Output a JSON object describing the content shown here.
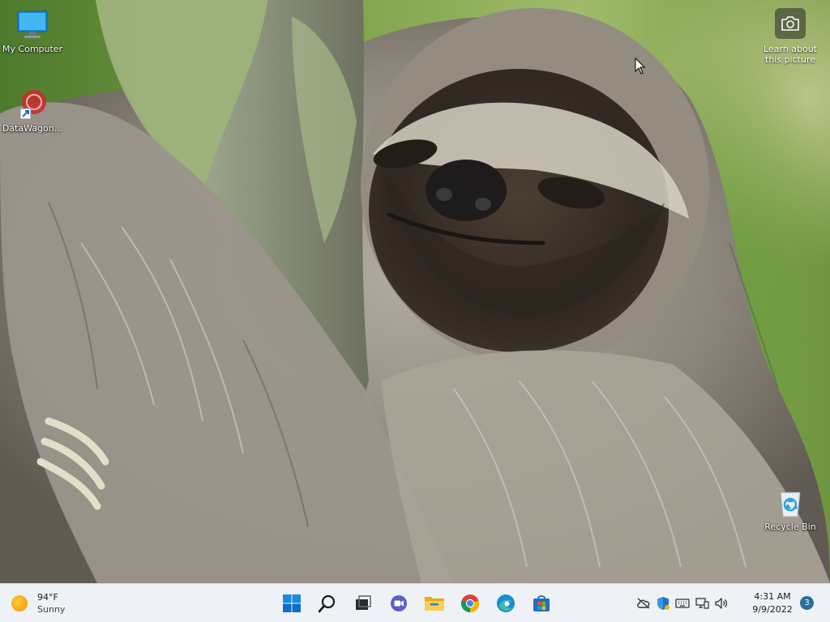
{
  "desktop": {
    "icons": [
      {
        "label": "My Computer",
        "icon": "monitor-icon"
      },
      {
        "label": "DataWagon...",
        "icon": "shortcut-icon"
      },
      {
        "label": "Recycle Bin",
        "icon": "recycle-bin-icon"
      }
    ],
    "learn_about": {
      "line1": "Learn about",
      "line2": "this picture",
      "icon": "camera-icon"
    }
  },
  "taskbar": {
    "weather": {
      "temp": "94°F",
      "condition": "Sunny",
      "icon": "sun-icon"
    },
    "apps": [
      {
        "name": "Start",
        "icon": "windows-start-icon"
      },
      {
        "name": "Search",
        "icon": "search-icon"
      },
      {
        "name": "Task View",
        "icon": "task-view-icon"
      },
      {
        "name": "Chat",
        "icon": "video-chat-icon"
      },
      {
        "name": "File Explorer",
        "icon": "folder-icon"
      },
      {
        "name": "Google Chrome",
        "icon": "chrome-icon"
      },
      {
        "name": "Microsoft Edge",
        "icon": "edge-icon"
      },
      {
        "name": "Microsoft Store",
        "icon": "store-icon"
      }
    ],
    "tray": {
      "icons": [
        "cloud-offline-icon",
        "security-shield-icon",
        "keyboard-icon",
        "network-icon",
        "speaker-icon"
      ]
    },
    "clock": {
      "time": "4:31 AM",
      "date": "9/9/2022"
    },
    "notifications": {
      "count": "3"
    }
  },
  "colors": {
    "taskbar_bg": "#eef1f5",
    "accent_blue": "#0067c0",
    "badge": "#2a6f9a"
  }
}
